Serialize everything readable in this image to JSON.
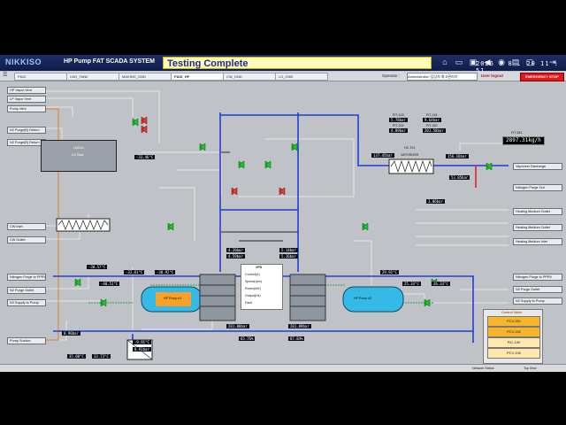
{
  "header": {
    "logo": "NIKKISO",
    "system_title": "HP Pump FAT SCADA  SYSTEM",
    "status_banner": "Testing Complete",
    "datetime": "2026 . 8 . 20   11 : 51",
    "icons": [
      "home-icon",
      "folder-open-icon",
      "save-icon",
      "speaker-icon",
      "camera-icon",
      "printer-icon",
      "monitor-icon",
      "logout-icon"
    ]
  },
  "tabbar": {
    "tabs": [
      "P&ID",
      "LNG_TANK",
      "MAKING_GND",
      "P&ID_HP",
      "CW_GND",
      "LG_GND"
    ],
    "active_index": 3,
    "operator_label": "Operator :",
    "operator_value": "Administrator/ 담당자 최고관리자",
    "logout_label": "User logout",
    "estop_label": "EMERGENCY STOP"
  },
  "left_nav": [
    "HP Vapor Vent",
    "LP Vapor Vent",
    "Pump Vent",
    "N2 Purge(B) Return",
    "N2 Purge(B) Return",
    "CW Inlet",
    "CW Outlet",
    "Nitrogen Purge to PPRV",
    "N2 Purge Outlet",
    "N2 Supply to Pump",
    "Pump Suction"
  ],
  "right_nav": [
    "Vaporizer Discharge",
    "Nitrogen Purge Out",
    "Heating Medium Outlet",
    "Heating Medium Outlet",
    "Heating Medium Inlet",
    "Nitrogen Purge to PPRV",
    "N2 Purge Outlet",
    "N2 Supply to Pump"
  ],
  "equipment": {
    "lng_tank_tag": "LNG1A",
    "lng_tank_label": "LG Tank",
    "vaporizer_tag": "HC-701",
    "vaporizer_label": "VAPORIZER",
    "pump_a_label": "HP Pump #1",
    "pump_b_label": "HP Pump #2"
  },
  "readings": {
    "pit_blocks": [
      {
        "tag": "PIT-103",
        "value": "5.78bar"
      },
      {
        "tag": "PIT-202",
        "value": "4.09bar"
      },
      {
        "tag": "PIT-115",
        "value": "9.64bar"
      },
      {
        "tag": "PIT-252",
        "value": "201.58bar"
      }
    ],
    "flow_tag": "FIT-281",
    "flow_value": "2897.31kg/h",
    "vapor_out": "137.45bar",
    "vaporizer_temp": "156.16bar",
    "vaporizer_pressure": "53.05bar",
    "tit_704": "3.06bar",
    "ttv": "-33.46°C",
    "lower_left": [
      "35.00°C",
      "33.73°C",
      "-30.57°C",
      "-48.51°C",
      "-32.61°C",
      "-30.92°C"
    ],
    "lower_right": [
      "29.91°C",
      "25.33°C",
      "26.33°C"
    ],
    "pump_mid": [
      "4.20bar",
      "4.59bar",
      "5.14bar",
      "5.16bar",
      "201.00bar",
      "201.09bar",
      "65.76%",
      "87.84%"
    ],
    "suction": [
      "0.90bar",
      "-9.91°C",
      "0.91bar"
    ]
  },
  "hp_panel": {
    "title": "VFD",
    "rows": [
      "Current(A)",
      "Speed(rpm)",
      "Power(kW)",
      "Output(Hz)",
      "Fault"
    ]
  },
  "control_valve": {
    "title": "Control Valve",
    "buttons": [
      "PCV-251",
      "PCV-252",
      "PIC-190",
      "PCV-190"
    ],
    "active": [
      "#f7b52b",
      "#f7b52b",
      "#ffe7b0",
      "#ffe7b0"
    ]
  },
  "status_bar": {
    "network": "Network Status",
    "view": "Top View"
  },
  "colors": {
    "lng_line": "#1f3fd6",
    "process_line": "#d9d9d9",
    "n2_line": "#3050ff",
    "hot_line": "#e22222",
    "valve_green": "#18c428",
    "pump_blue": "#35b9e6"
  }
}
